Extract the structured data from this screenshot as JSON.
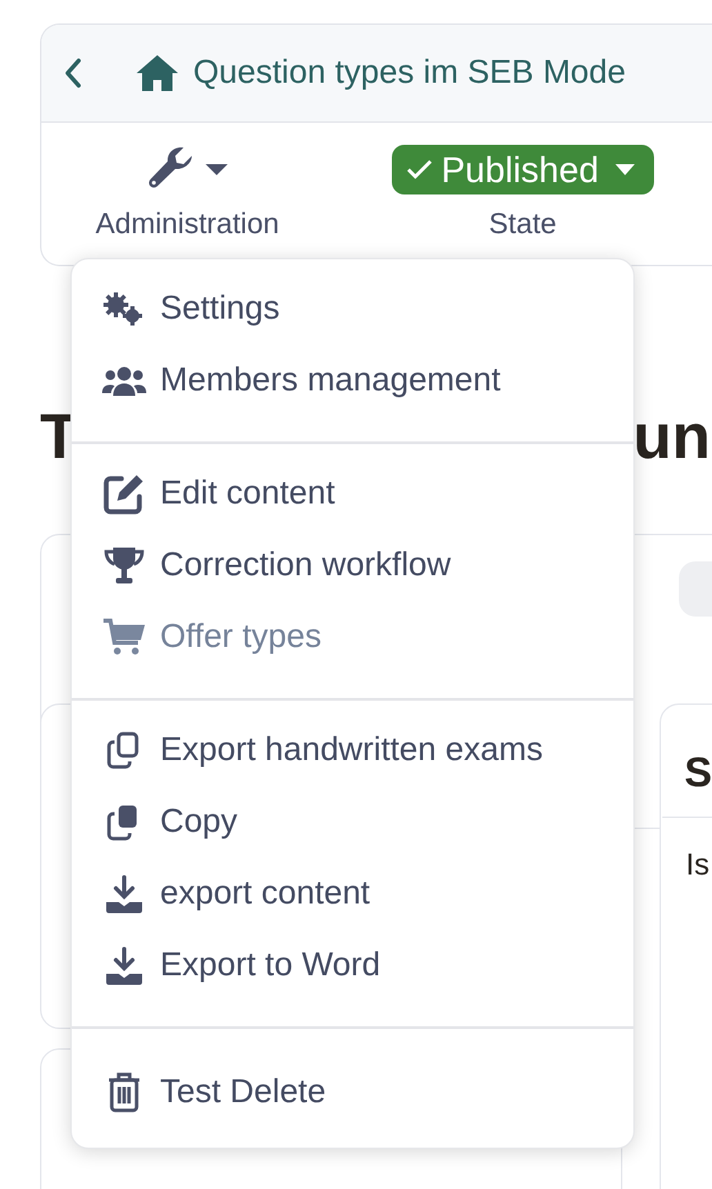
{
  "header": {
    "title": "Question types im SEB Mode",
    "tools": [
      {
        "kind": "admin",
        "label": "Administration"
      },
      {
        "kind": "state",
        "label": "State",
        "value": "Published"
      }
    ]
  },
  "background": {
    "heading_start": "T",
    "heading_end": "un",
    "side_card_title": "S",
    "side_card_text": "Is"
  },
  "menu": {
    "groups": [
      [
        {
          "label": "Settings",
          "disabled": false
        },
        {
          "label": "Members management",
          "disabled": false
        }
      ],
      [
        {
          "label": "Edit content",
          "disabled": false
        },
        {
          "label": "Correction workflow",
          "disabled": false
        },
        {
          "label": "Offer types",
          "disabled": true
        }
      ],
      [
        {
          "label": "Export handwritten exams",
          "disabled": false
        },
        {
          "label": "Copy",
          "disabled": false
        },
        {
          "label": "export content",
          "disabled": false
        },
        {
          "label": "Export to Word",
          "disabled": false
        }
      ],
      [
        {
          "label": "Test Delete",
          "disabled": false
        }
      ]
    ]
  }
}
